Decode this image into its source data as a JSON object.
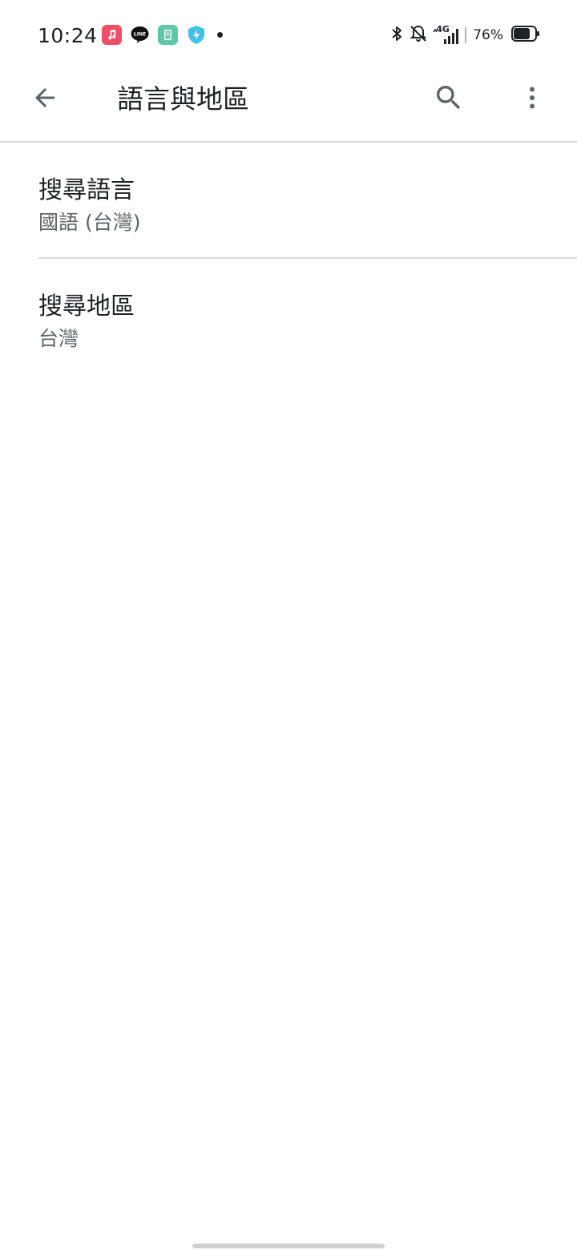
{
  "status_bar": {
    "time": "10:24",
    "battery_percent": "76%",
    "network_label": "4G",
    "notification_icons": [
      "music-app-icon",
      "line-app-icon",
      "teal-app-icon",
      "shield-app-icon",
      "more-notifications-dot"
    ],
    "system_icons": [
      "bluetooth-icon",
      "bell-off-icon",
      "signal-4g-icon",
      "battery-icon"
    ]
  },
  "app_bar": {
    "title": "語言與地區",
    "back_icon": "arrow-back-icon",
    "search_icon": "search-icon",
    "more_icon": "more-vert-icon"
  },
  "settings": [
    {
      "title": "搜尋語言",
      "value": "國語 (台灣)"
    },
    {
      "title": "搜尋地區",
      "value": "台灣"
    }
  ],
  "colors": {
    "text_primary": "#202124",
    "text_secondary": "#5f6368",
    "icon": "#5f6368",
    "divider": "#dadce0",
    "music_app": "#ee4f67",
    "teal_app": "#5fc6a9",
    "shield_app": "#3fc1e8"
  }
}
